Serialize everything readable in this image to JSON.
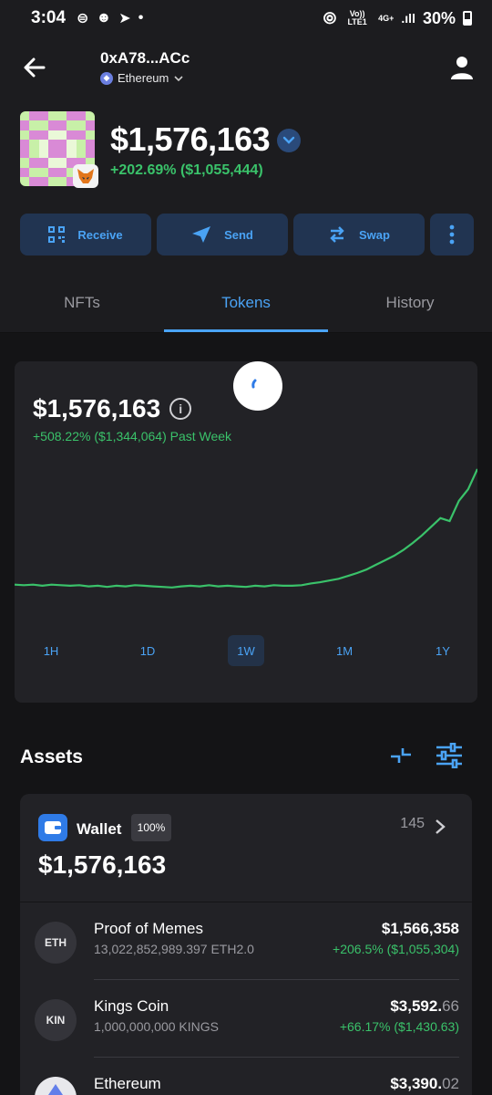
{
  "status_bar": {
    "time": "3:04",
    "network_top": "Vo)) LTE1",
    "network_gen": "4G+",
    "battery": "30%"
  },
  "header": {
    "address": "0xA78...ACc",
    "network": "Ethereum"
  },
  "balance": {
    "value": "$1,576,163",
    "change": "+202.69% ($1,055,444)"
  },
  "actions": [
    {
      "label": "Receive"
    },
    {
      "label": "Send"
    },
    {
      "label": "Swap"
    }
  ],
  "tabs": [
    {
      "label": "NFTs"
    },
    {
      "label": "Tokens",
      "active": true
    },
    {
      "label": "History"
    }
  ],
  "chart": {
    "value": "$1,576,163",
    "change": "+508.22% ($1,344,064) Past Week",
    "ranges": [
      "1H",
      "1D",
      "1W",
      "1M",
      "1Y"
    ],
    "active_range": "1W",
    "line_color": "#3ac26a"
  },
  "chart_data": {
    "type": "line",
    "title": "",
    "xlabel": "",
    "ylabel": "",
    "series": [
      {
        "values": [
          0.4,
          0.39,
          0.4,
          0.38,
          0.4,
          0.39,
          0.38,
          0.39,
          0.37,
          0.38,
          0.36,
          0.38,
          0.37,
          0.39,
          0.38,
          0.37,
          0.36,
          0.35,
          0.37,
          0.38,
          0.37,
          0.39,
          0.37,
          0.38,
          0.37,
          0.36,
          0.38,
          0.37,
          0.39,
          0.38,
          0.38,
          0.39,
          0.42,
          0.44,
          0.47,
          0.5,
          0.55,
          0.6,
          0.66,
          0.74,
          0.82,
          0.9,
          1.0,
          1.12,
          1.25,
          1.4,
          1.55,
          1.5,
          1.85,
          2.05,
          2.4
        ]
      }
    ]
  },
  "assets": {
    "title": "Assets",
    "wallet": {
      "label": "Wallet",
      "percent": "100%",
      "count": "145",
      "total": "$1,576,163",
      "tokens": [
        {
          "icon": "ETH",
          "name": "Proof of Memes",
          "amount": "13,022,852,989.397 ETH2.0",
          "value_main": "$1,566,358",
          "value_dim": "",
          "change": "+206.5% ($1,055,304)"
        },
        {
          "icon": "KIN",
          "name": "Kings Coin",
          "amount": "1,000,000,000 KINGS",
          "value_main": "$3,592.",
          "value_dim": "66",
          "change": "+66.17% ($1,430.63)"
        },
        {
          "icon": "eth-logo",
          "name": "Ethereum",
          "amount": "",
          "value_main": "$3,390.",
          "value_dim": "02",
          "change": ""
        }
      ]
    }
  },
  "colors": {
    "accent": "#4aa3f5",
    "positive": "#3ac26a",
    "button_bg": "#213451"
  }
}
